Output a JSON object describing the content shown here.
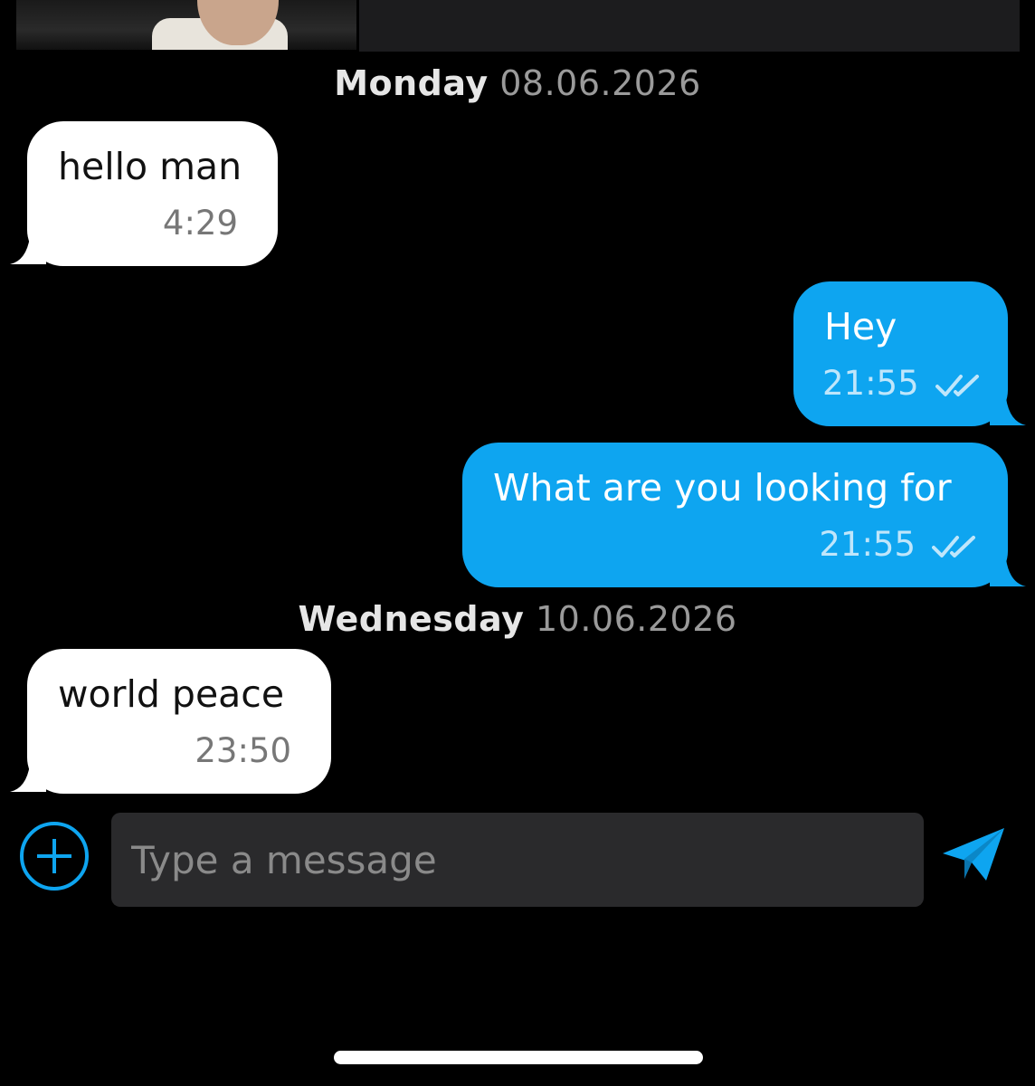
{
  "colors": {
    "background": "#000000",
    "incoming_bubble": "#ffffff",
    "outgoing_bubble": "#0ea5f0",
    "accent": "#0ea5f0",
    "input_background": "#2a2a2c"
  },
  "separators": [
    {
      "day": "Monday",
      "date": "08.06.2026"
    },
    {
      "day": "Wednesday",
      "date": "10.06.2026"
    }
  ],
  "messages": [
    {
      "direction": "incoming",
      "text": "hello man",
      "time": "4:29"
    },
    {
      "direction": "outgoing",
      "text": "Hey",
      "time": "21:55",
      "status": "read"
    },
    {
      "direction": "outgoing",
      "text": "What are you looking for",
      "time": "21:55",
      "status": "read"
    },
    {
      "direction": "incoming",
      "text": "world peace",
      "time": "23:50"
    }
  ],
  "composer": {
    "placeholder": "Type a message",
    "value": "",
    "attach_icon": "plus-circle-icon",
    "send_icon": "send-icon"
  }
}
